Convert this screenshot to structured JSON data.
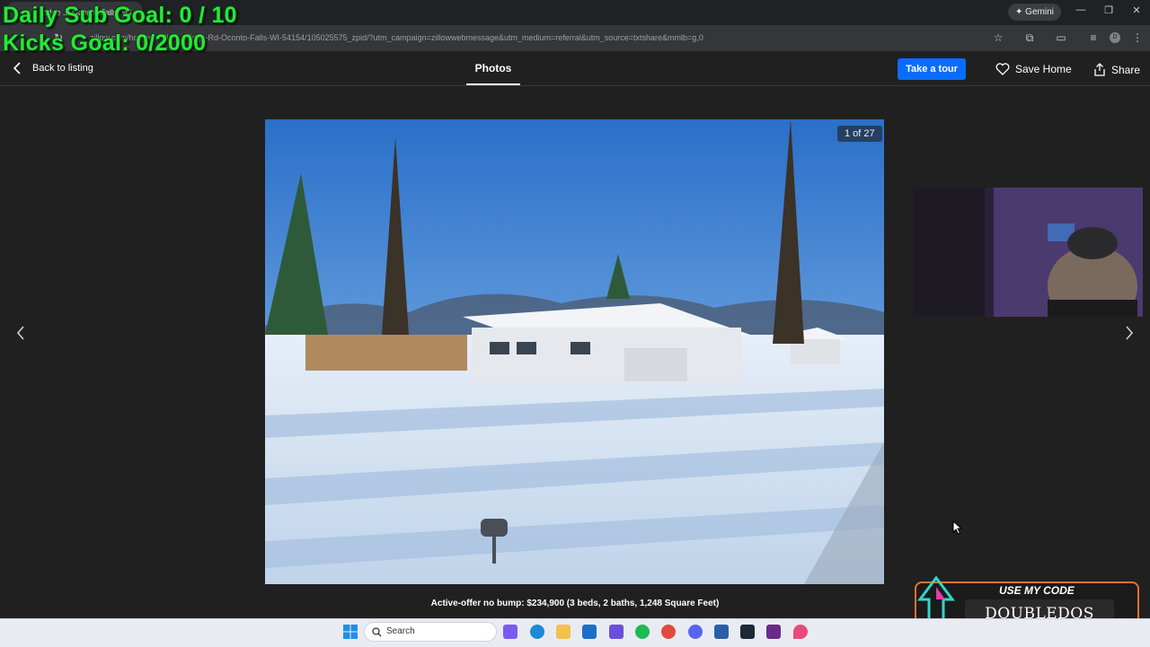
{
  "browser": {
    "tab_title": "Ridge ... Oconto Falls, WI ...",
    "url": "zillow.com/homedetails/...-Ridge-Rd-Oconto-Falls-WI-54154/105025575_zpid/?utm_campaign=zillowwebmessage&utm_medium=referral&utm_source=txtshare&mmlb=g,0",
    "gemini_label": "Gemini",
    "profile_initial": "D"
  },
  "overlay": {
    "sub_goal": "Daily Sub Goal: 0 / 10",
    "kicks_goal": "Kicks Goal: 0/2000"
  },
  "header": {
    "back_label": "Back to listing",
    "photos_tab": "Photos",
    "tour_button": "Take a tour",
    "save_home": "Save Home",
    "share": "Share"
  },
  "gallery": {
    "counter": "1 of 27",
    "caption": "Active-offer no bump: $234,900 (3 beds, 2 baths, 1,248 Square Feet)"
  },
  "promo": {
    "heading": "USE MY CODE",
    "code": "DOUBLEDOS"
  },
  "taskbar": {
    "search_placeholder": "Search"
  },
  "colors": {
    "page_bg": "#202020",
    "accent_blue": "#0a6cff",
    "overlay_green": "#27e83a",
    "promo_orange": "#e8722a"
  }
}
